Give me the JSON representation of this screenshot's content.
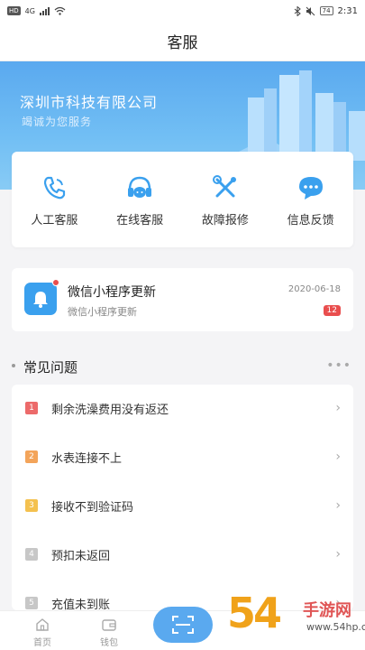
{
  "status_bar": {
    "hd": "HD",
    "network": "4G",
    "battery": "74",
    "time": "2:31"
  },
  "nav": {
    "title": "客服"
  },
  "hero": {
    "company": "深圳市科技有限公司",
    "slogan": "竭诚为您服务"
  },
  "services": [
    {
      "label": "人工客服",
      "icon": "phone-icon"
    },
    {
      "label": "在线客服",
      "icon": "headset-icon"
    },
    {
      "label": "故障报修",
      "icon": "tools-icon"
    },
    {
      "label": "信息反馈",
      "icon": "chat-bubble-icon"
    }
  ],
  "notice": {
    "title": "微信小程序更新",
    "subtitle": "微信小程序更新",
    "date": "2020-06-18",
    "count": "12",
    "icon": "bell-icon"
  },
  "faq": {
    "title": "常见问题",
    "more": "•••",
    "items": [
      {
        "num": "1",
        "text": "剩余洗澡费用没有返还",
        "color": "#ec6a6a"
      },
      {
        "num": "2",
        "text": "水表连接不上",
        "color": "#f3a45a"
      },
      {
        "num": "3",
        "text": "接收不到验证码",
        "color": "#f4c14f"
      },
      {
        "num": "4",
        "text": "预扣未返回",
        "color": "#c7c7c7"
      },
      {
        "num": "5",
        "text": "充值未到账",
        "color": "#c7c7c7"
      }
    ]
  },
  "tabbar": {
    "home": "首页",
    "wallet": "钱包"
  },
  "watermark": {
    "logo": "54",
    "text": "手游网",
    "url": "www.54hp.com"
  },
  "colors": {
    "accent": "#5aa9ef",
    "badge": "#e94e4e",
    "icon_blue": "#3aa0ee"
  }
}
